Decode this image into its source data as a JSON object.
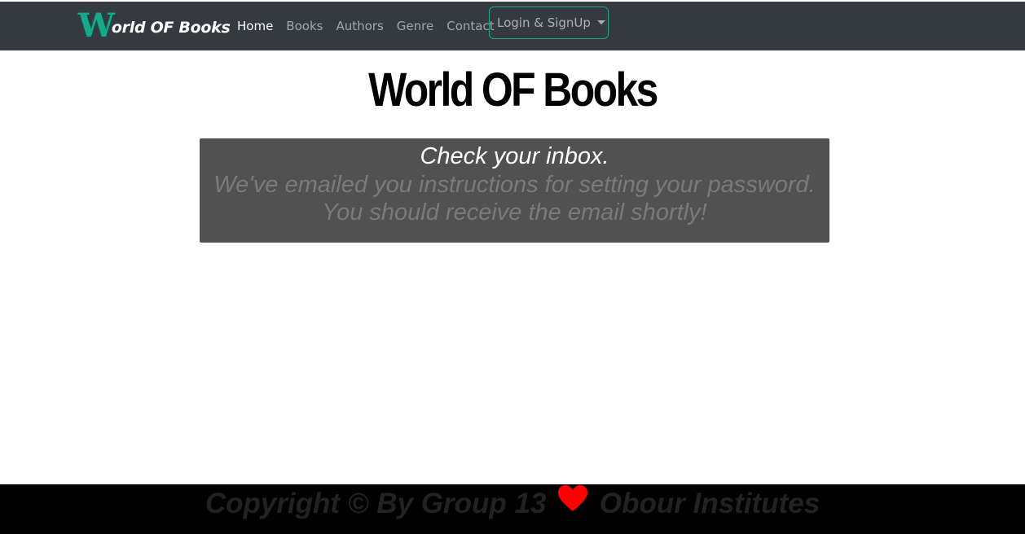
{
  "navbar": {
    "brand_first_letter": "W",
    "brand_rest": "orld OF Books",
    "links": [
      {
        "label": "Home",
        "active": true
      },
      {
        "label": "Books",
        "active": false
      },
      {
        "label": "Authors",
        "active": false
      },
      {
        "label": "Genre",
        "active": false
      },
      {
        "label": "Contact",
        "active": false
      }
    ],
    "dropdown_label": "Login & SignUp"
  },
  "main": {
    "title": "World OF Books",
    "alert": {
      "heading": "Check your inbox.",
      "line1": "We've emailed you instructions for setting your password.",
      "line2": "You should receive the email shortly!"
    }
  },
  "footer": {
    "text_before": "Copyright © By Group 13",
    "text_after": "Obour Institutes",
    "heart_icon": "heart-icon",
    "heart_color": "#ff0000"
  },
  "colors": {
    "navbar_bg": "#343a40",
    "accent": "#1aa88a",
    "alert_bg": "#515151",
    "footer_bg": "#000000"
  }
}
